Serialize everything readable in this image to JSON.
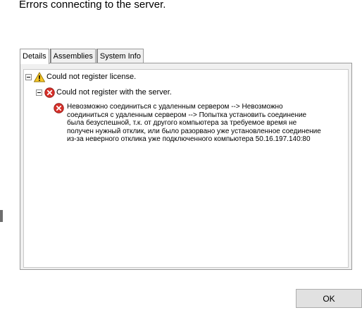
{
  "dialog": {
    "heading": "Errors connecting to the server.",
    "ok_label": "OK"
  },
  "tabs": [
    {
      "label": "Details",
      "active": true
    },
    {
      "label": "Assemblies",
      "active": false
    },
    {
      "label": "System Info",
      "active": false
    }
  ],
  "tree": {
    "root": {
      "icon": "warning-icon",
      "label": "Could not register license."
    },
    "child": {
      "icon": "error-icon",
      "label": "Could not register with the server."
    },
    "message": {
      "icon": "error-icon",
      "text": "Невозможно соединиться с удаленным сервером --> Невозможно\nсоединиться с удаленным сервером --> Попытка установить соединение\nбыла безуспешной, т.к. от другого компьютера за требуемое время не\nполучен нужный отклик, или было разорвано уже установленное соединение\nиз-за неверного отклика уже подключенного компьютера 50.16.197.140:80"
    }
  },
  "colors": {
    "error_red": "#d7302a",
    "warning_yellow": "#f6c626"
  }
}
